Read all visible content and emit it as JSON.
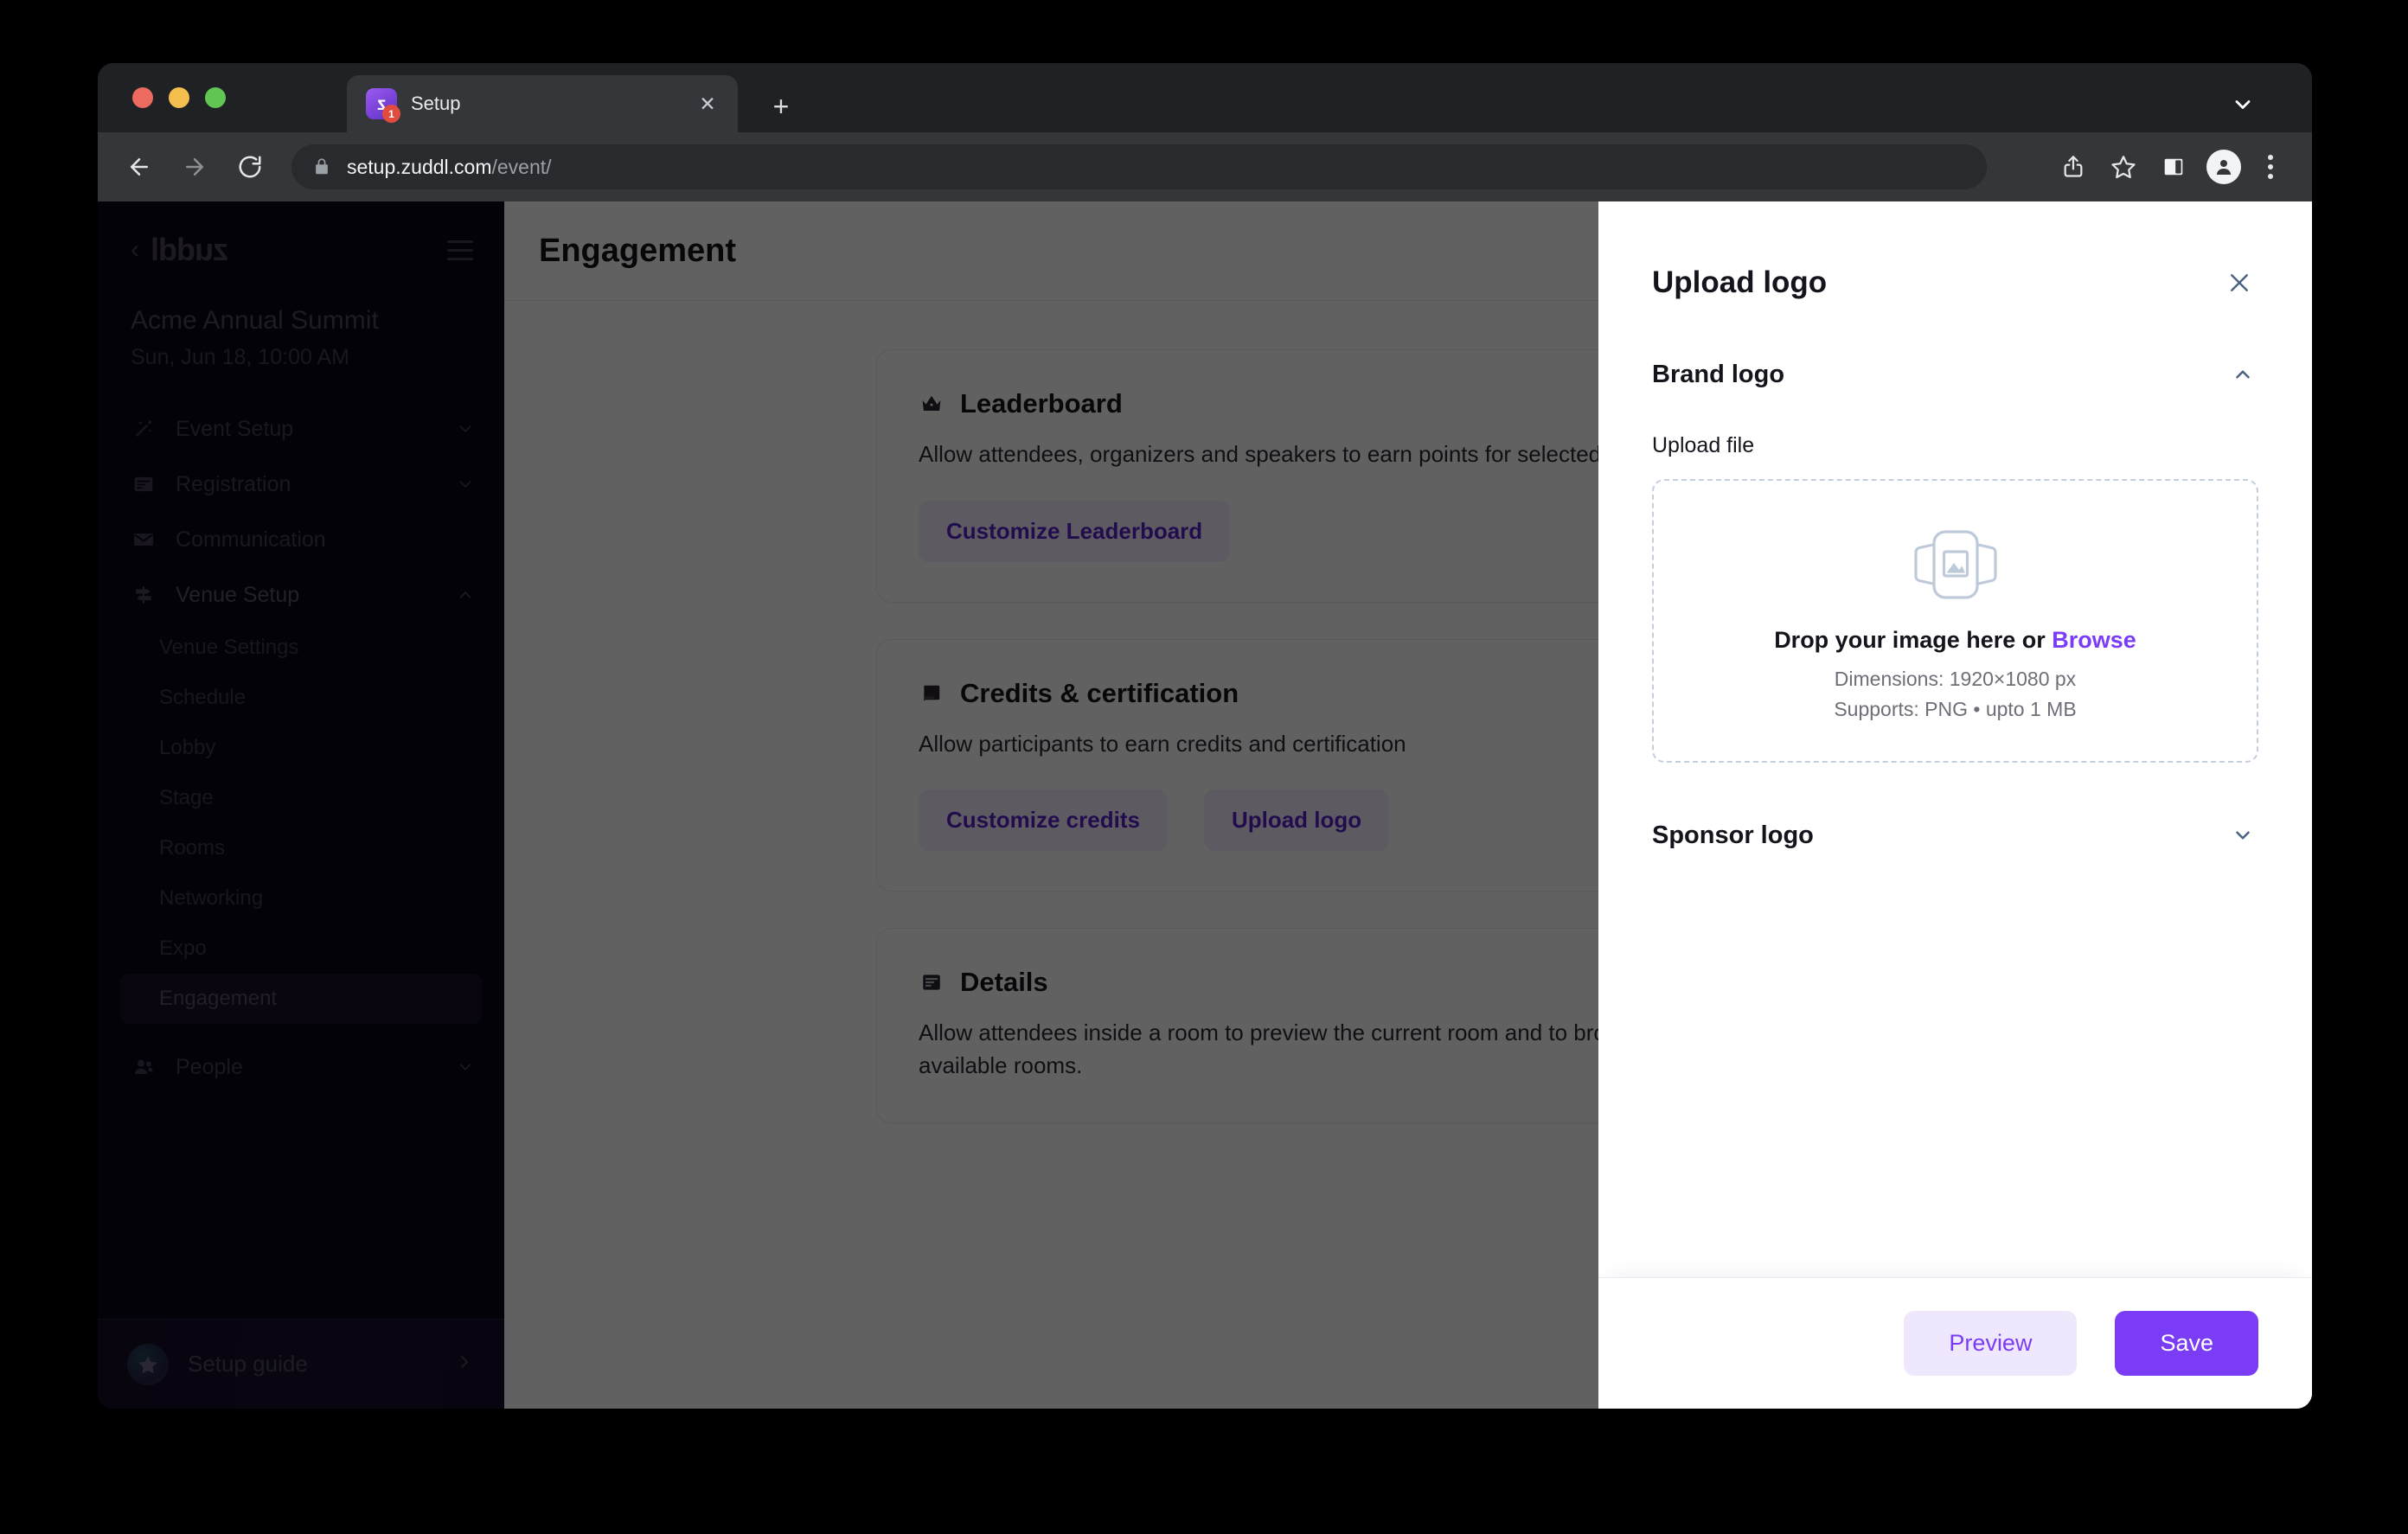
{
  "browser": {
    "tab": {
      "title": "Setup",
      "favicon_letter": "z",
      "badge_count": "1",
      "close_label": "✕"
    },
    "new_tab_label": "+",
    "url_host": "setup.zuddl.com",
    "url_path": "/event/",
    "icons": {
      "back": "back-arrow-icon",
      "forward": "forward-arrow-icon",
      "reload": "reload-icon",
      "lock": "lock-icon",
      "share": "share-icon",
      "bookmark": "star-icon",
      "side_panel": "side-panel-icon",
      "profile": "profile-avatar-icon",
      "menu": "three-dots-menu-icon",
      "tab_list": "chevron-down-icon"
    }
  },
  "sidebar": {
    "brand": "zuddl",
    "collapse_label": "‹",
    "event_name": "Acme Annual Summit",
    "event_date": "Sun, Jun 18, 10:00 AM",
    "nav": [
      {
        "label": "Event Setup",
        "icon": "magic-wand-icon",
        "chevron": "down"
      },
      {
        "label": "Registration",
        "icon": "form-icon",
        "chevron": "down"
      },
      {
        "label": "Communication",
        "icon": "envelope-icon",
        "chevron": "none"
      },
      {
        "label": "Venue Setup",
        "icon": "signpost-icon",
        "chevron": "up"
      }
    ],
    "venue_children": [
      {
        "label": "Venue Settings",
        "selected": false
      },
      {
        "label": "Schedule",
        "selected": false
      },
      {
        "label": "Lobby",
        "selected": false
      },
      {
        "label": "Stage",
        "selected": false
      },
      {
        "label": "Rooms",
        "selected": false
      },
      {
        "label": "Networking",
        "selected": false
      },
      {
        "label": "Expo",
        "selected": false
      },
      {
        "label": "Engagement",
        "selected": true
      }
    ],
    "people": {
      "label": "People",
      "icon": "people-icon",
      "chevron": "down"
    },
    "setup_guide": {
      "label": "Setup guide",
      "icon": "star-icon",
      "chevron": "›"
    }
  },
  "main": {
    "page_title": "Engagement",
    "cards": [
      {
        "icon": "crown-icon",
        "title": "Leaderboard",
        "description": "Allow attendees, organizers and speakers to earn points for selected actions",
        "buttons": [
          "Customize Leaderboard"
        ]
      },
      {
        "icon": "certificate-icon",
        "title": "Credits & certification",
        "description": "Allow participants to earn credits and certification",
        "buttons": [
          "Customize credits",
          "Upload logo"
        ]
      },
      {
        "icon": "details-icon",
        "title": "Details",
        "description": "Allow attendees inside a room to preview the current room and to browse through other available rooms.",
        "buttons": []
      }
    ]
  },
  "modal": {
    "title": "Upload logo",
    "close_label": "✕",
    "sections": [
      {
        "title": "Brand logo",
        "expanded": true,
        "chevron": "up"
      },
      {
        "title": "Sponsor logo",
        "expanded": false,
        "chevron": "down"
      }
    ],
    "upload_file_label": "Upload file",
    "dropzone": {
      "icon": "image-placeholder-icon",
      "prompt_prefix": "Drop your image here or ",
      "browse_label": "Browse",
      "dimensions": "Dimensions: 1920×1080 px",
      "supports": "Supports: PNG • upto 1 MB"
    },
    "footer": {
      "preview_label": "Preview",
      "save_label": "Save"
    }
  },
  "colors": {
    "accent_purple": "#7B3CF5",
    "accent_purple_soft": "#EFE8FD",
    "link_purple": "#5B21CC",
    "sidebar_bg": "#0C0718",
    "dropzone_border": "#C4CFDE"
  }
}
